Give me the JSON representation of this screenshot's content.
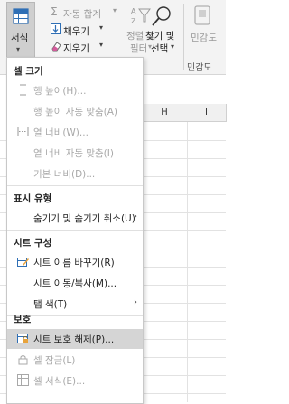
{
  "ribbon": {
    "format_label": "서식",
    "autosum_label": "자동 합계",
    "fill_label": "채우기",
    "clear_label": "지우기",
    "sort_filter_label_1": "정렬 및",
    "sort_filter_label_2": "필터",
    "find_select_label_1": "찾기 및",
    "find_select_label_2": "선택",
    "sensitivity_label_1": "민감도",
    "sensitivity_label_2": "",
    "sensitivity_group_label": "민감도"
  },
  "sheet": {
    "column_headers": [
      "H",
      "I"
    ]
  },
  "menu": {
    "cell_size_heading": "셀 크기",
    "row_height": "행 높이(H)...",
    "autofit_row_height": "행 높이 자동 맞춤(A)",
    "column_width": "열 너비(W)...",
    "autofit_column_width": "열 너비 자동 맞춤(I)",
    "default_width": "기본 너비(D)...",
    "visibility_heading": "표시 유형",
    "hide_unhide": "숨기기 및 숨기기 취소(U)",
    "organize_heading": "시트 구성",
    "rename_sheet": "시트 이름 바꾸기(R)",
    "move_copy_sheet": "시트 이동/복사(M)...",
    "tab_color": "탭 색(T)",
    "protection_heading": "보호",
    "unprotect_sheet": "시트 보호 해제(P)...",
    "lock_cell": "셀 잠금(L)",
    "format_cells": "셀 서식(E)..."
  }
}
